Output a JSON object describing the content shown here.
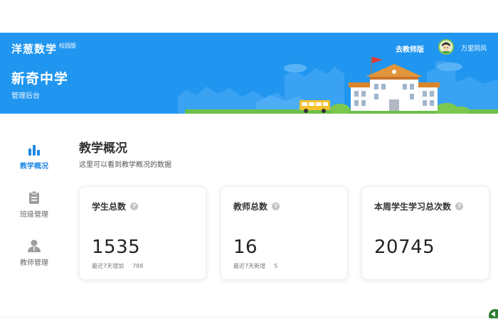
{
  "header": {
    "brand": "洋葱数学",
    "edition": "校园版",
    "school_name": "新奇中学",
    "subtitle": "管理后台",
    "teacher_link": "去教师版",
    "username": "万里同风"
  },
  "sidebar": {
    "items": [
      {
        "label": "教学概况",
        "icon": "bar-chart-icon",
        "active": true
      },
      {
        "label": "班级管理",
        "icon": "clipboard-icon",
        "active": false
      },
      {
        "label": "教师管理",
        "icon": "person-icon",
        "active": false
      }
    ]
  },
  "main": {
    "title": "教学概况",
    "description": "这里可以看到教学概况的数据",
    "cards": [
      {
        "title": "学生总数",
        "value": "1535",
        "foot_label": "最近7天增加",
        "foot_value": "788"
      },
      {
        "title": "教师总数",
        "value": "16",
        "foot_label": "最近7天新增",
        "foot_value": "5"
      },
      {
        "title": "本周学生学习总次数",
        "value": "20745"
      }
    ]
  },
  "colors": {
    "banner": "#2196f0",
    "accent": "#1e88e5"
  }
}
